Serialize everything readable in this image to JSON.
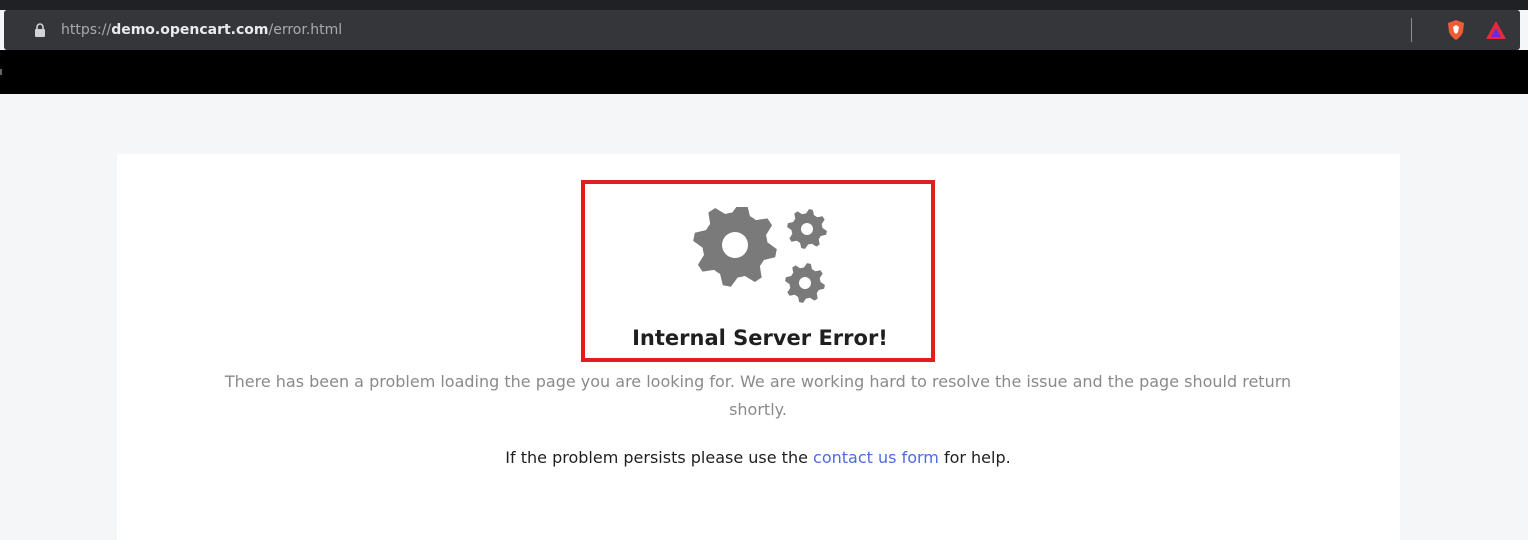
{
  "browser": {
    "url_scheme": "https://",
    "url_domain": "demo.opencart.com",
    "url_path": "/error.html",
    "extensions": [
      {
        "icon": "brave-shield-icon",
        "color": "#ef5b34"
      },
      {
        "icon": "brave-rewards-icon",
        "color": "#e7293a"
      }
    ]
  },
  "error": {
    "icon": "gears-icon",
    "title": "Internal Server Error!",
    "description": "There has been a problem loading the page you are looking for. We are working hard to resolve the issue and the page should return shortly.",
    "help_prefix": "If the problem persists please use the ",
    "help_link": "contact us form",
    "help_suffix": " for help."
  },
  "annotation": {
    "color": "#e31d1d"
  },
  "colors": {
    "link": "#4e6be0",
    "icon_gray": "#7a7a7a"
  }
}
